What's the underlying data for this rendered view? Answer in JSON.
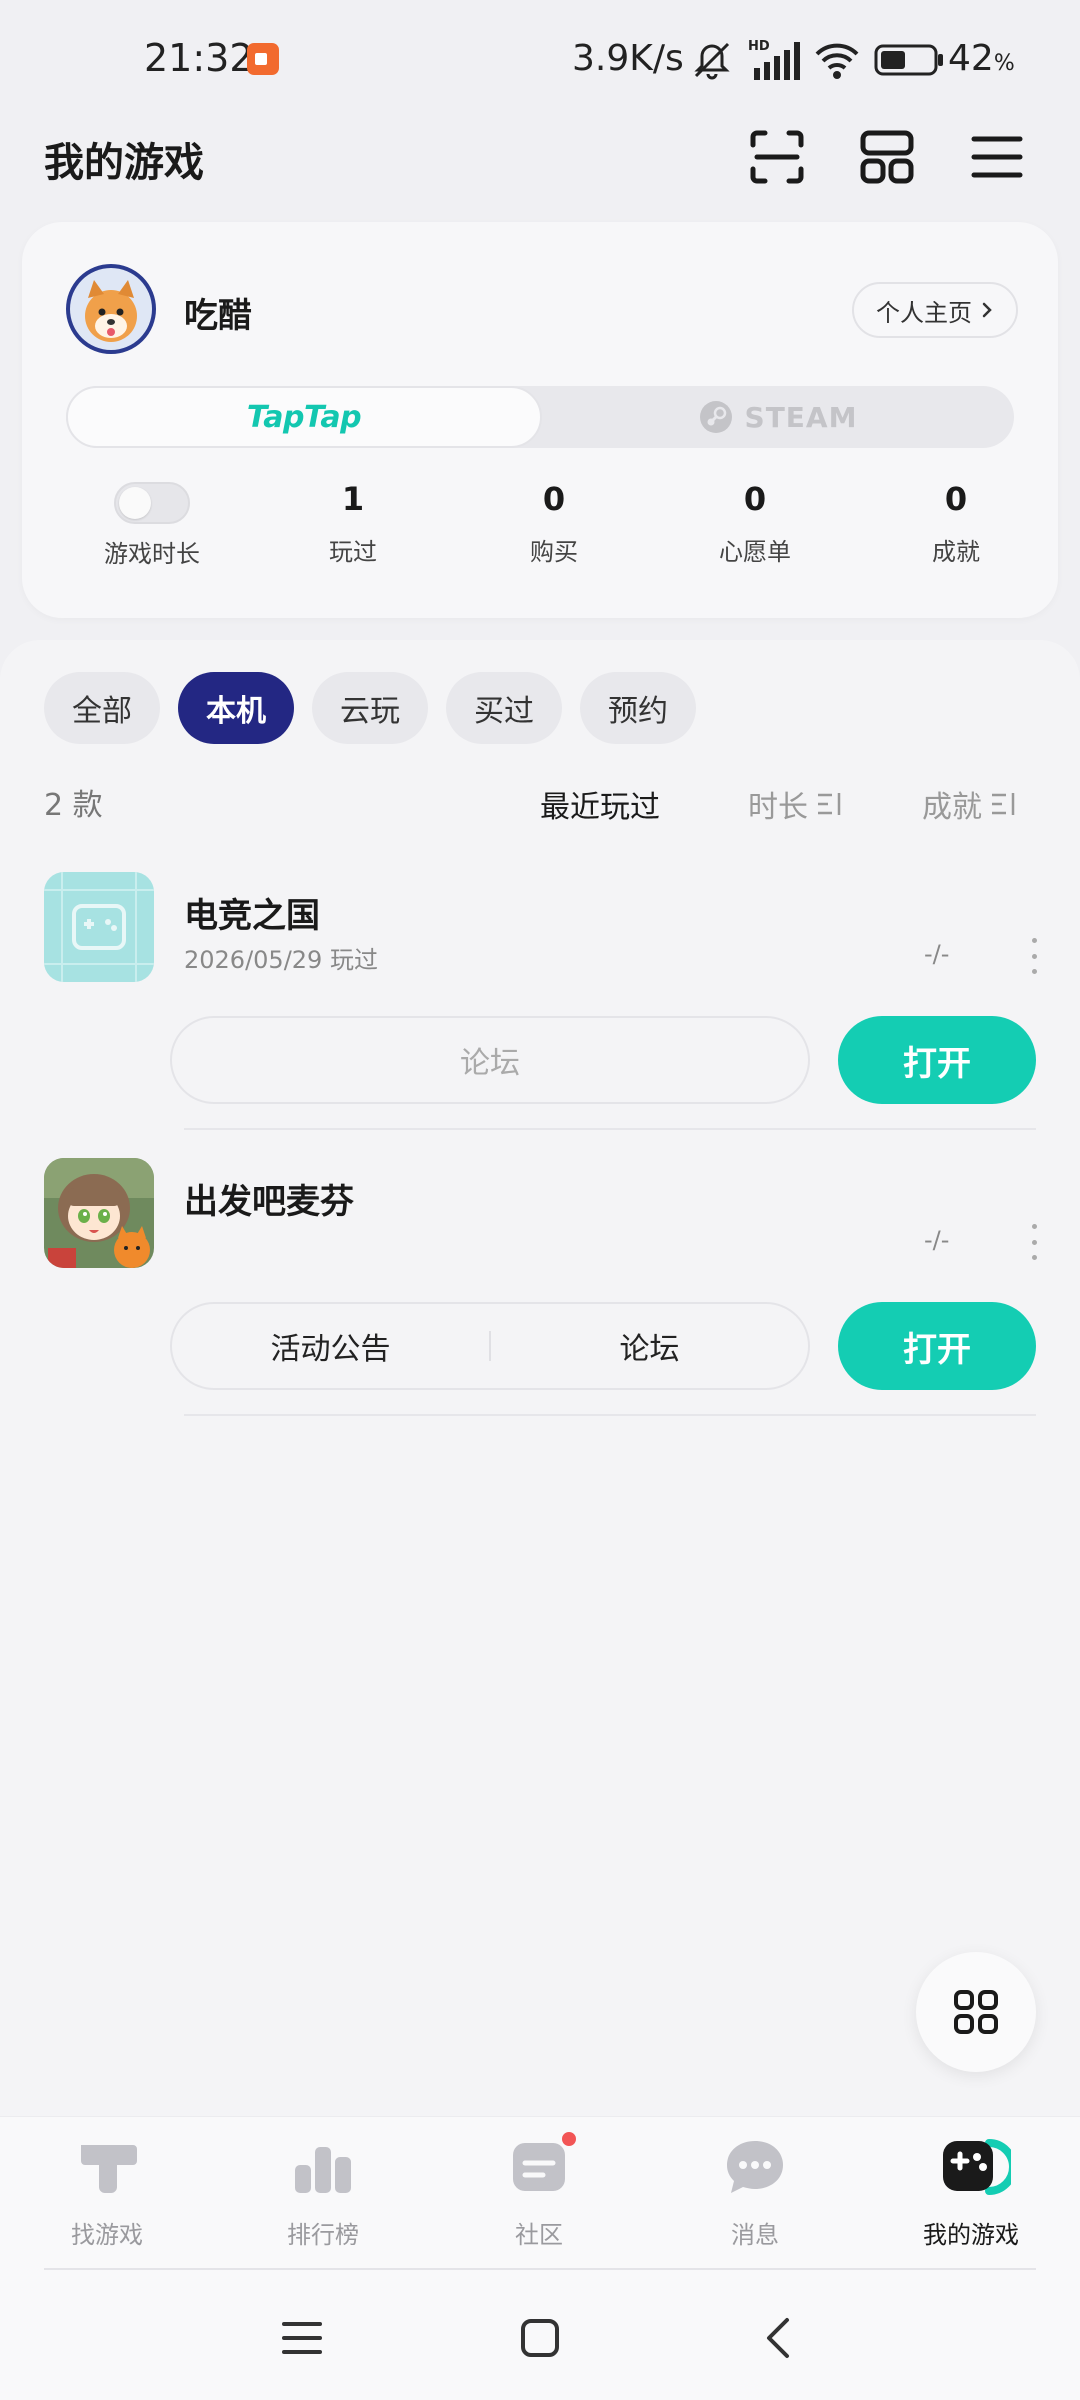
{
  "status_bar": {
    "time": "21:32",
    "net_speed": "3.9K/s",
    "battery_pct": "42",
    "battery_unit": "%",
    "hd_label": "HD",
    "icons": [
      "screen-record-icon",
      "mute-icon",
      "signal-icon",
      "wifi-icon",
      "battery-icon"
    ]
  },
  "header": {
    "title": "我的游戏",
    "actions": [
      "scan-icon",
      "layout-icon",
      "menu-icon"
    ]
  },
  "profile": {
    "username": "吃醋",
    "homepage_label": "个人主页",
    "platforms": {
      "taptap": "TapTap",
      "steam": "STEAM",
      "selected": "taptap"
    },
    "stats": [
      {
        "label": "游戏时长",
        "value": ""
      },
      {
        "label": "玩过",
        "value": "1"
      },
      {
        "label": "购买",
        "value": "0"
      },
      {
        "label": "心愿单",
        "value": "0"
      },
      {
        "label": "成就",
        "value": "0"
      }
    ]
  },
  "filters": {
    "tabs": [
      "全部",
      "本机",
      "云玩",
      "买过",
      "预约"
    ],
    "active": "本机"
  },
  "list": {
    "count_label": "2 款",
    "sort": {
      "recent": "最近玩过",
      "duration": "时长",
      "achievement": "成就",
      "active": "最近玩过"
    },
    "games": [
      {
        "name": "电竞之国",
        "subtitle": "2026/05/29 玩过",
        "duration": "-/-",
        "links": [
          "论坛"
        ],
        "open_label": "打开"
      },
      {
        "name": "出发吧麦芬",
        "subtitle": "",
        "duration": "-/-",
        "links": [
          "活动公告",
          "论坛"
        ],
        "open_label": "打开"
      }
    ]
  },
  "bottom_nav": {
    "items": [
      {
        "label": "找游戏",
        "icon": "taptap-t-icon"
      },
      {
        "label": "排行榜",
        "icon": "ranking-icon"
      },
      {
        "label": "社区",
        "icon": "community-icon",
        "badge": true
      },
      {
        "label": "消息",
        "icon": "message-icon"
      },
      {
        "label": "我的游戏",
        "icon": "gamepad-icon",
        "active": true
      }
    ]
  },
  "colors": {
    "accent": "#14cdb3",
    "active_tab": "#232783",
    "badge": "#f25555"
  }
}
